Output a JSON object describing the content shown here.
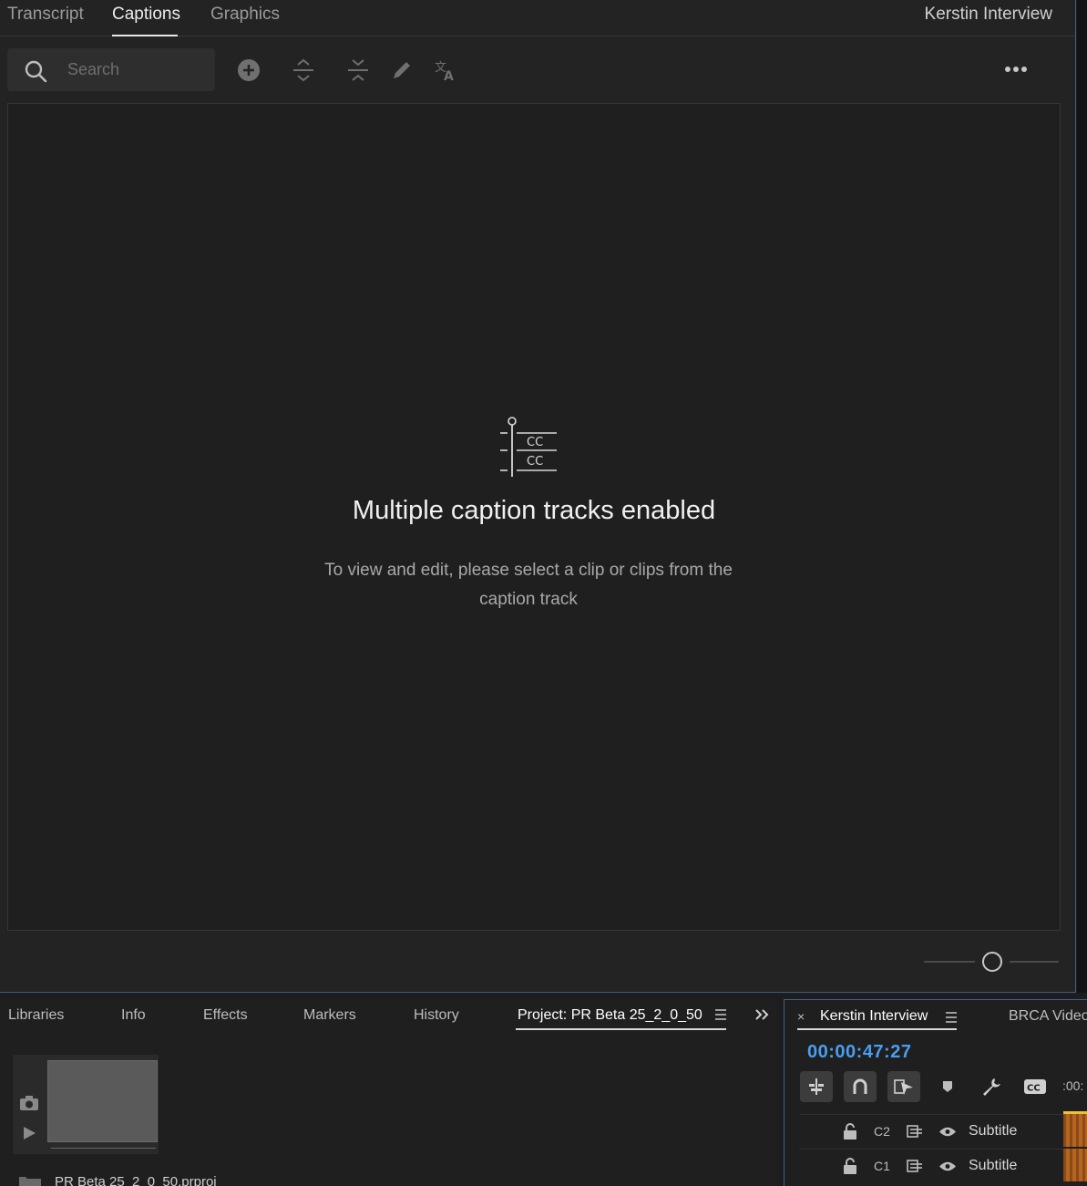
{
  "text_panel": {
    "tabs": [
      "Transcript",
      "Captions",
      "Graphics"
    ],
    "active_tab": "Captions",
    "sequence_name": "Kerstin Interview",
    "search": {
      "placeholder": "Search",
      "value": ""
    },
    "toolbar_icons": [
      "add-caption-icon",
      "merge-captions-icon",
      "split-caption-icon",
      "edit-icon",
      "translate-icon",
      "more-options-icon"
    ],
    "empty_state": {
      "icon": "caption-tracks-icon",
      "icon_text": "CC",
      "title": "Multiple caption tracks enabled",
      "description": "To view and edit, please select a clip or clips from the caption track"
    },
    "zoom_level": 0.5
  },
  "bottom_left": {
    "tabs": [
      "Libraries",
      "Info",
      "Effects",
      "Markers",
      "History",
      "Project: PR Beta 25_2_0_50"
    ],
    "active_tab": "Project: PR Beta 25_2_0_50",
    "project_file": "PR Beta 25_2_0_50.prproj"
  },
  "timeline": {
    "close_label": "×",
    "sequence_tab": "Kerstin Interview",
    "other_tab": "BRCA Video",
    "timecode": "00:00:47:27",
    "ruler_label": ":00:",
    "tool_icons": [
      "nest-icon",
      "snap-icon",
      "linked-selection-icon",
      "add-marker-icon",
      "settings-wrench-icon",
      "captions-icon"
    ],
    "tracks": [
      {
        "id": "C2",
        "name": "Subtitle"
      },
      {
        "id": "C1",
        "name": "Subtitle"
      }
    ],
    "accent_color": "#4a9ef0",
    "playhead_color": "#e8c23a",
    "clip_color": "#b5651d"
  }
}
